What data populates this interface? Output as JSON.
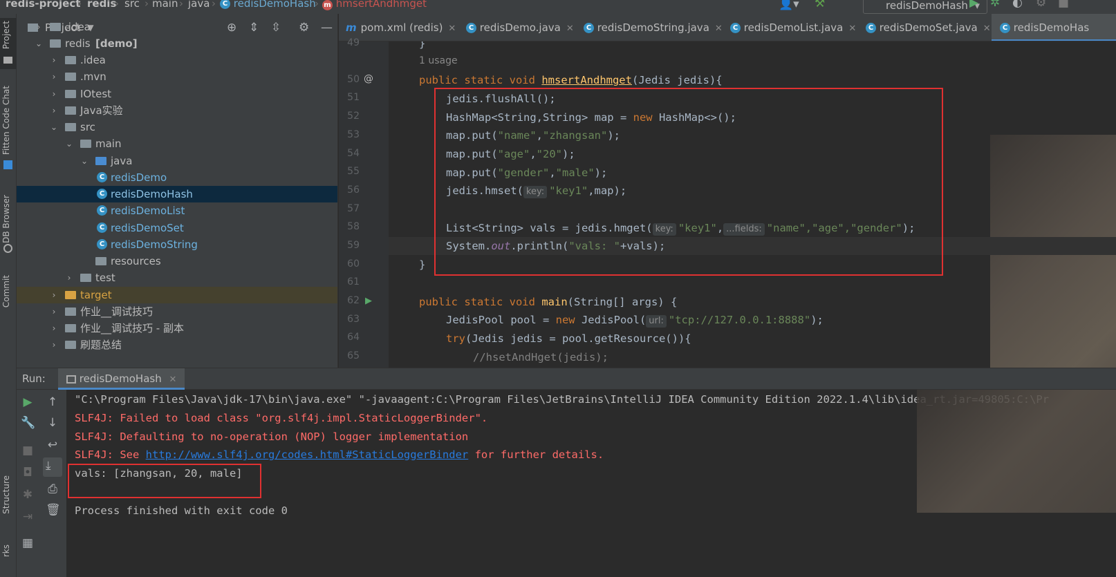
{
  "navbar": {
    "breadcrumbs": [
      "redis-project",
      "redis",
      "src",
      "main",
      "java",
      "redisDemoHash",
      "hmsertAndhmget"
    ],
    "run_config": "redisDemoHash"
  },
  "sidebar_left": {
    "tools": [
      "Project",
      "Fitten Code Chat",
      "DB Browser",
      "Commit",
      "Structure",
      "rks"
    ]
  },
  "project": {
    "title": "Project",
    "tree": [
      {
        "label": ".idea",
        "type": "folder"
      },
      {
        "label": "redis",
        "bold_suffix": "[demo]",
        "type": "module"
      },
      {
        "label": ".idea",
        "type": "folder"
      },
      {
        "label": ".mvn",
        "type": "folder"
      },
      {
        "label": "IOtest",
        "type": "folder"
      },
      {
        "label": "Java实验",
        "type": "folder"
      },
      {
        "label": "src",
        "type": "folder"
      },
      {
        "label": "main",
        "type": "folder"
      },
      {
        "label": "java",
        "type": "source"
      },
      {
        "label": "redisDemo",
        "type": "class"
      },
      {
        "label": "redisDemoHash",
        "type": "class"
      },
      {
        "label": "redisDemoList",
        "type": "class"
      },
      {
        "label": "redisDemoSet",
        "type": "class"
      },
      {
        "label": "redisDemoString",
        "type": "class"
      },
      {
        "label": "resources",
        "type": "folder"
      },
      {
        "label": "test",
        "type": "folder"
      },
      {
        "label": "target",
        "type": "excluded"
      },
      {
        "label": "作业__调试技巧",
        "type": "folder"
      },
      {
        "label": "作业__调试技巧 - 副本",
        "type": "folder"
      },
      {
        "label": "刷题总结",
        "type": "folder"
      }
    ]
  },
  "tabs": [
    {
      "label": "pom.xml (redis)",
      "icon": "maven-icon"
    },
    {
      "label": "redisDemo.java",
      "icon": "class-icon"
    },
    {
      "label": "redisDemoString.java",
      "icon": "class-icon"
    },
    {
      "label": "redisDemoList.java",
      "icon": "class-icon"
    },
    {
      "label": "redisDemoSet.java",
      "icon": "class-icon"
    },
    {
      "label": "redisDemoHas",
      "icon": "class-icon"
    }
  ],
  "editor": {
    "line_numbers": [
      "49",
      "50",
      "51",
      "52",
      "53",
      "54",
      "55",
      "56",
      "57",
      "58",
      "59",
      "60",
      "61",
      "62",
      "63",
      "64",
      "65"
    ],
    "usage_hint": "1 usage",
    "code": {
      "l49": "}",
      "l50_kw": "public static void",
      "l50_fn": "hmsertAndhmget",
      "l50_rest": "(Jedis jedis){",
      "l51": "jedis.flushAll();",
      "l52_a": "HashMap<String,String> map = ",
      "l52_kw": "new",
      "l52_b": " HashMap<>();",
      "l53_a": "map.put(",
      "l53_s1": "\"name\"",
      "l53_s2": "\"zhangsan\"",
      "l53_b": ");",
      "l54_a": "map.put(",
      "l54_s1": "\"age\"",
      "l54_s2": "\"20\"",
      "l54_b": ");",
      "l55_a": "map.put(",
      "l55_s1": "\"gender\"",
      "l55_s2": "\"male\"",
      "l55_b": ");",
      "l56_a": "jedis.hmset(",
      "l56_hint": "key:",
      "l56_s": "\"key1\"",
      "l56_b": ",map);",
      "l58_a": "List<String> vals = jedis.hmget(",
      "l58_hint1": "key:",
      "l58_s1": "\"key1\"",
      "l58_hint2": "...fields:",
      "l58_s2": "\"name\",\"age\",\"gender\"",
      "l58_b": ");",
      "l59_a": "System.",
      "l59_fld": "out",
      "l59_b": ".println(",
      "l59_s": "\"vals: \"",
      "l59_c": "+vals);",
      "l60": "}",
      "l62_kw": "public static void",
      "l62_fn": "main",
      "l62_rest": "(String[] args) {",
      "l63_a": "JedisPool pool = ",
      "l63_kw": "new",
      "l63_b": " JedisPool(",
      "l63_hint": "url:",
      "l63_s": "\"tcp://127.0.0.1:8888\"",
      "l63_c": ");",
      "l64_kw": "try",
      "l64_rest": "(Jedis jedis = pool.getResource()){",
      "l65": "//hsetAndHget(jedis);"
    }
  },
  "run": {
    "label": "Run:",
    "tab": "redisDemoHash",
    "output": {
      "cmd": "\"C:\\Program Files\\Java\\jdk-17\\bin\\java.exe\" \"-javaagent:C:\\Program Files\\JetBrains\\IntelliJ IDEA Community Edition 2022.1.4\\lib\\idea_rt.jar=49805:C:\\Pr",
      "err1": "SLF4J: Failed to load class \"org.slf4j.impl.StaticLoggerBinder\".",
      "err2": "SLF4J: Defaulting to no-operation (NOP) logger implementation",
      "err3_a": "SLF4J: See ",
      "err3_link": "http://www.slf4j.org/codes.html#StaticLoggerBinder",
      "err3_b": " for further details.",
      "result": "vals: [zhangsan, 20, male]",
      "exit": "Process finished with exit code 0"
    }
  },
  "colors": {
    "editor_bg": "#2b2b2b",
    "panel_bg": "#3c3f41",
    "highlight_box": "#e03131",
    "keyword": "#cc7832",
    "string": "#6a8759",
    "error_text": "#ff6b68"
  }
}
